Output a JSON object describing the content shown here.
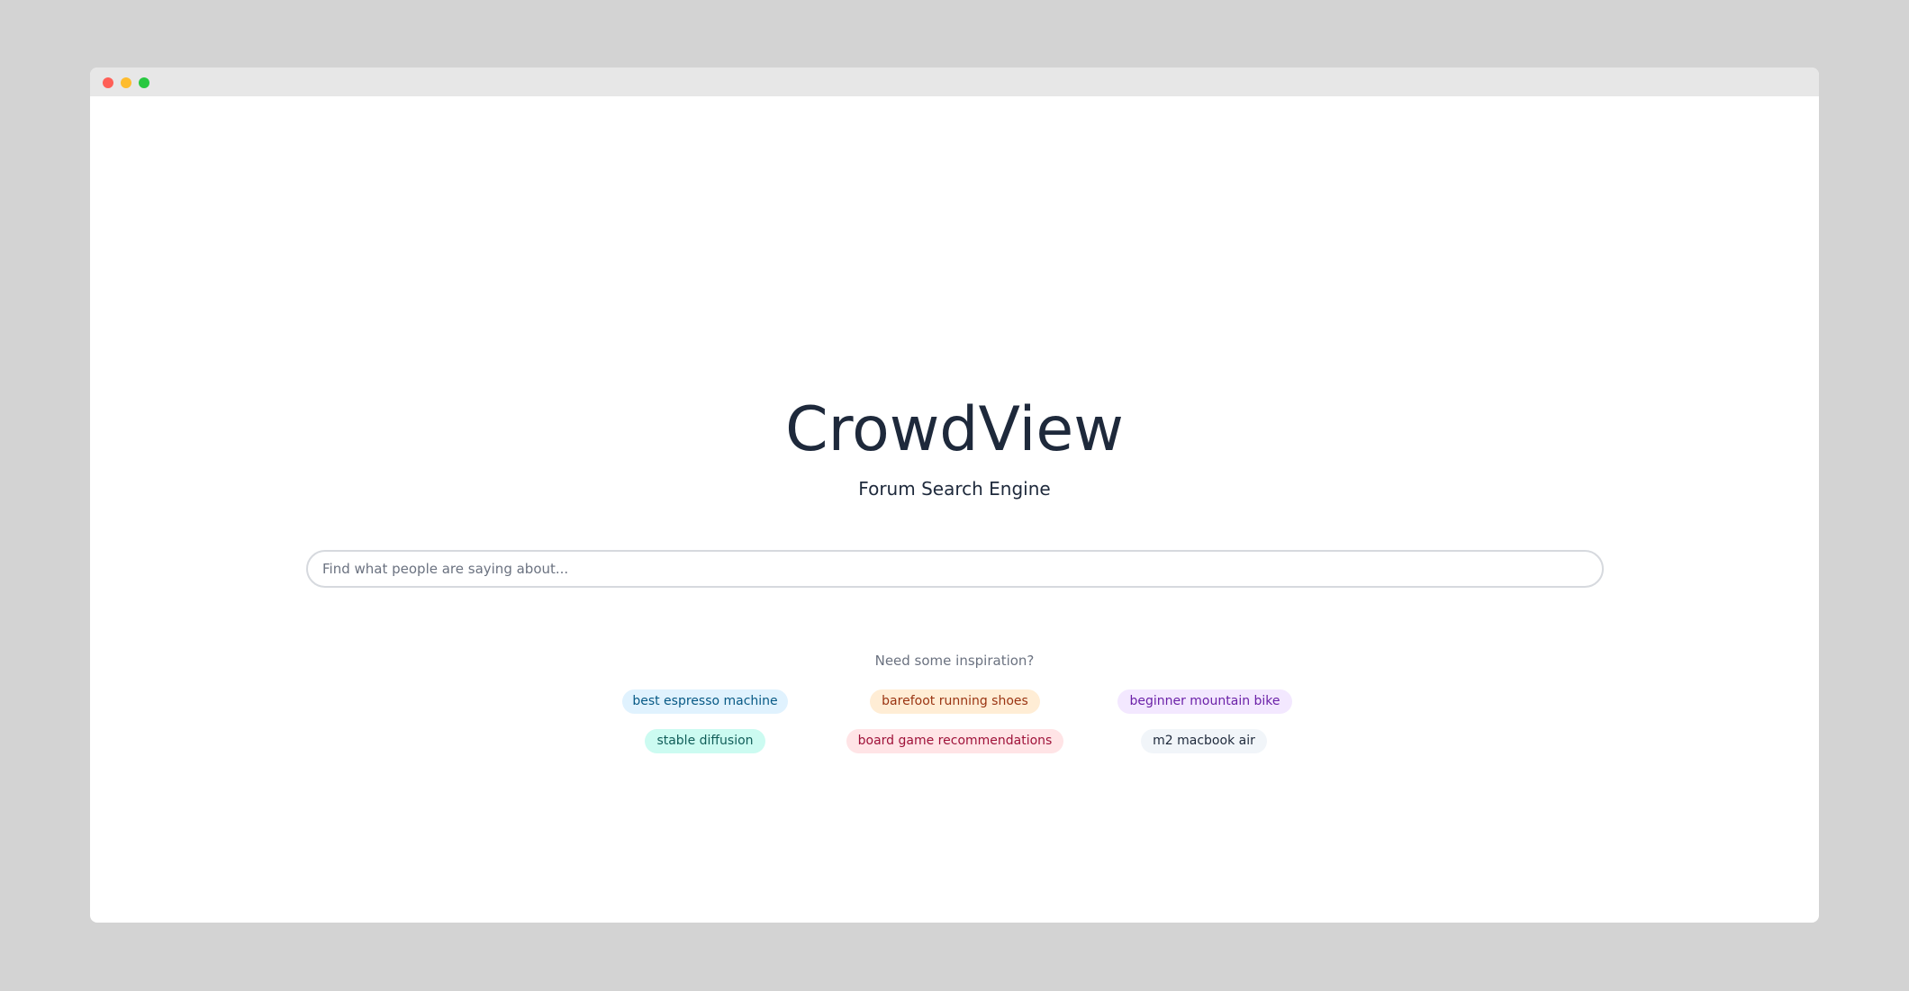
{
  "app": {
    "title": "CrowdView",
    "subtitle": "Forum Search Engine"
  },
  "search": {
    "placeholder": "Find what people are saying about...",
    "value": ""
  },
  "inspiration": {
    "label": "Need some inspiration?",
    "chips": [
      {
        "label": "best espresso machine",
        "bg": "#e0f2fe",
        "fg": "#075985"
      },
      {
        "label": "barefoot running shoes",
        "bg": "#ffedd5",
        "fg": "#9a3412"
      },
      {
        "label": "beginner mountain bike",
        "bg": "#f3e8ff",
        "fg": "#6b21a8"
      },
      {
        "label": "stable diffusion",
        "bg": "#ccfbf1",
        "fg": "#115e59"
      },
      {
        "label": "board game recommendations",
        "bg": "#ffe4e6",
        "fg": "#9f1239"
      },
      {
        "label": "m2 macbook air",
        "bg": "#f1f5f9",
        "fg": "#1e293b"
      }
    ]
  }
}
